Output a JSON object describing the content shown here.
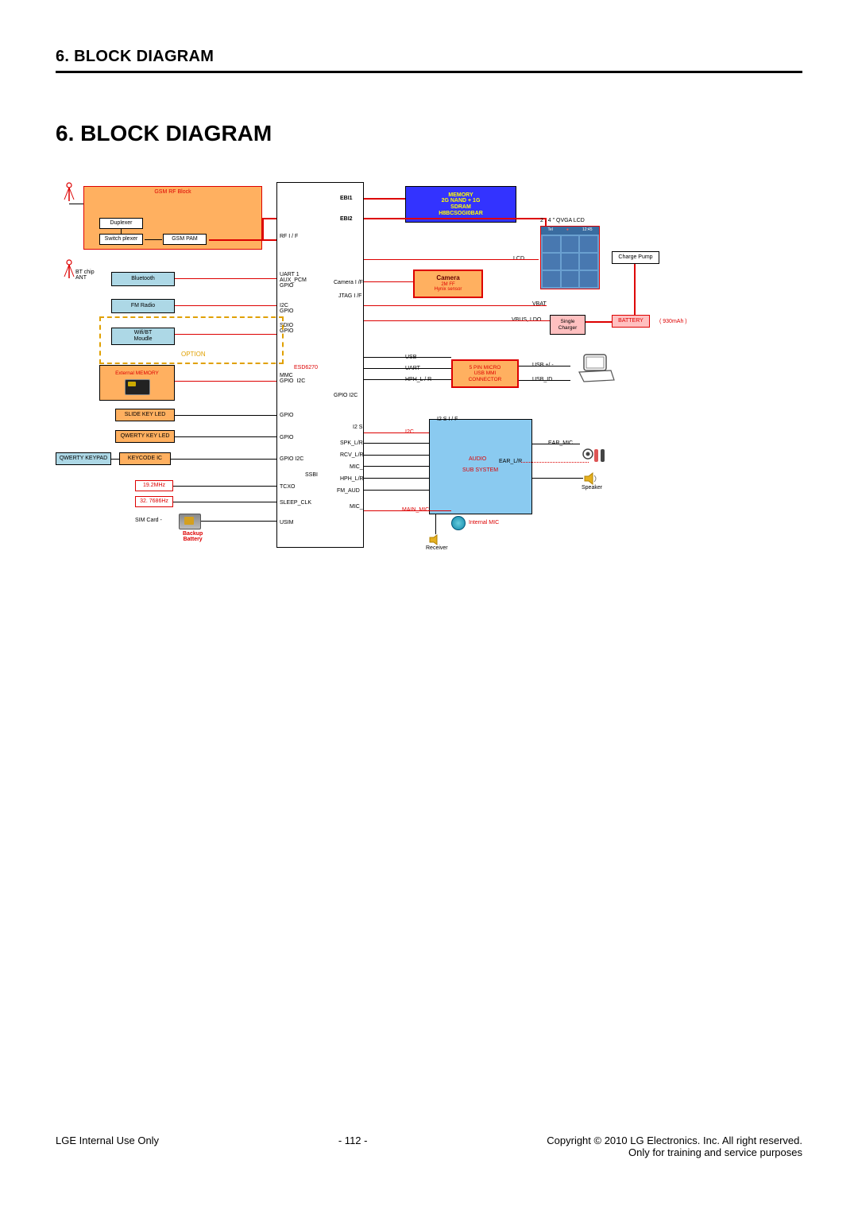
{
  "header": "6. BLOCK DIAGRAM",
  "title": "6. BLOCK DIAGRAM",
  "footer": {
    "left": "LGE Internal Use Only",
    "center": "- 112 -",
    "right1": "Copyright © 2010 LG Electronics. Inc. All right reserved.",
    "right2": "Only for training and service purposes"
  },
  "rfblock": {
    "title": "GSM   RF Block",
    "duplexer": "Duplexer",
    "switch": "Switch   plexer",
    "pam": "GSM PAM"
  },
  "left_col": {
    "bt_chip_ant": "BT chip\nANT",
    "bluetooth": "Bluetooth",
    "fm": "FM Radio",
    "wifi": "Wifi/BT\nMoudle",
    "option": "OPTION",
    "extmem": "External MEMORY",
    "slide_led": "SLIDE KEY LED",
    "qwerty_led": "QWERTY KEY LED",
    "qwerty_kp": "QWERTY KEYPAD",
    "keycode": "KEYCODE IC",
    "osc1": "19.2MHz",
    "osc2": "32. 7686Hz",
    "sim": "SIM Card   -",
    "backup": "Backup\nBattery"
  },
  "cpu": {
    "name": "ESD6270",
    "rfif": "RF I  / F",
    "uart1": "UART 1\nAUX_PCM\nGPIO",
    "i2c_gpio": "I2C\nGPIO",
    "sdio_gpio": "SDIO\nGPIO",
    "mmc_gpio": "MMC\nGPIO  I2C",
    "gpio1": "GPIO",
    "gpio2": "GPIO",
    "gpio3": "GPIO  I2C",
    "ssbi": "SSBI",
    "tcxo": "TCXO",
    "sleepclk": "SLEEP_CLK",
    "usim": "USIM",
    "ebi1": "EBI1",
    "ebi2": "EBI2",
    "cam": "Camera I /F",
    "jtag": "JTAG I /F",
    "gpio_i2c_r": "GPIO   I2C",
    "i2s_r": "I2 S",
    "spk": "SPK_L/R",
    "rcv": "RCV_L/R",
    "mic": "MIC_",
    "hph": "HPH_L/R",
    "fmaud": "FM_AUD",
    "mic2": "MIC_"
  },
  "right_col": {
    "memory_title": "MEMORY",
    "memory_l1": "2G NAND + 1G",
    "memory_l2": "SDRAM",
    "memory_l3": "H8BCSOGI0BAR",
    "lcd_label": "2 . 4 \"   QVGA LCD",
    "lcd": "LCD",
    "chargepump": "Charge Pump",
    "camera": "Camera",
    "camera_l1": "2M FF",
    "camera_l2": "Hynix sensor",
    "vbat": "VBAT",
    "vbus": "VBUS, LDO",
    "charger": "Single\nCharger",
    "battery": "BATTERY",
    "battery_cap": "( 930mAh )",
    "usb": "USB",
    "uart": "UART",
    "hphlr": "HPH_L / R",
    "conn_l1": "5    PIN MICRO",
    "conn_l2": "USB MMI",
    "conn_l3": "CONNECTOR",
    "usbpm": "USB +/ -",
    "usbid": "USB_ID",
    "i2s": "I2  S I / F",
    "i2c": "I2C",
    "audio": "AUDIO",
    "subsys": "SUB SYSTEM",
    "ear_mic": "EAR_MIC",
    "ear_lr": "EAR_L/R",
    "speaker": "Speaker",
    "internal_mic": "Internal MIC",
    "main_mic": "MAIN_MIC",
    "receiver": "Receiver"
  }
}
